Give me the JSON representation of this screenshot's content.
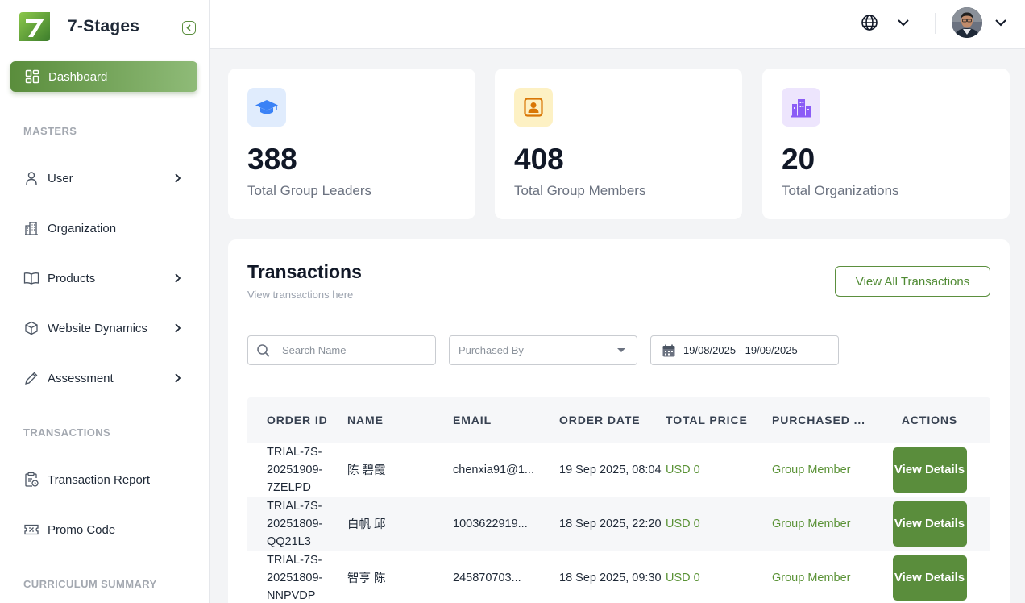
{
  "brand": {
    "name": "7-Stages"
  },
  "sidebar": {
    "active": {
      "label": "Dashboard"
    },
    "sections": {
      "masters": "MASTERS",
      "transactions": "TRANSACTIONS",
      "curriculum": "CURRICULUM SUMMARY"
    },
    "items": [
      {
        "label": "User",
        "icon": "user-icon",
        "has_children": true
      },
      {
        "label": "Organization",
        "icon": "building-icon",
        "has_children": false
      },
      {
        "label": "Products",
        "icon": "book-icon",
        "has_children": true
      },
      {
        "label": "Website Dynamics",
        "icon": "cube-icon",
        "has_children": true
      },
      {
        "label": "Assessment",
        "icon": "pencil-icon",
        "has_children": true
      },
      {
        "label": "Transaction Report",
        "icon": "report-icon",
        "has_children": false
      },
      {
        "label": "Promo Code",
        "icon": "ticket-icon",
        "has_children": false
      }
    ]
  },
  "stats": [
    {
      "value": "388",
      "label": "Total Group Leaders",
      "icon": "graduation-cap-icon",
      "color": "#3b82f6",
      "bg": "#e0ecfd"
    },
    {
      "value": "408",
      "label": "Total Group Members",
      "icon": "id-badge-icon",
      "color": "#d97706",
      "bg": "#fdf1c4"
    },
    {
      "value": "20",
      "label": "Total Organizations",
      "icon": "city-icon",
      "color": "#8b5cf6",
      "bg": "#ede5fd"
    }
  ],
  "transactions": {
    "title": "Transactions",
    "subtitle": "View transactions here",
    "view_all": "View All Transactions",
    "search_placeholder": "Search Name",
    "purchased_by_placeholder": "Purchased By",
    "date_range": "19/08/2025 - 19/09/2025",
    "columns": [
      "ORDER ID",
      "NAME",
      "EMAIL",
      "ORDER DATE",
      "TOTAL PRICE",
      "PURCHASED ...",
      "ACTIONS"
    ],
    "rows": [
      {
        "order_id": "TRIAL-7S-20251909-7ZELPD",
        "name": "陈 碧霞",
        "email": "chenxia91@1...",
        "date": "19 Sep 2025, 08:04",
        "price": "USD 0",
        "purchased_by": "Group Member",
        "action": "View Details"
      },
      {
        "order_id": "TRIAL-7S-20251809-QQ21L3",
        "name": "白帆 邱",
        "email": "1003622919...",
        "date": "18 Sep 2025, 22:20",
        "price": "USD 0",
        "purchased_by": "Group Member",
        "action": "View Details"
      },
      {
        "order_id": "TRIAL-7S-20251809-NNPVDP",
        "name": "智亨 陈",
        "email": "245870703...",
        "date": "18 Sep 2025, 09:30",
        "price": "USD 0",
        "purchased_by": "Group Member",
        "action": "View Details"
      }
    ]
  },
  "colors": {
    "accent": "#5a8d3c",
    "accent_light": "#8fbb78"
  }
}
